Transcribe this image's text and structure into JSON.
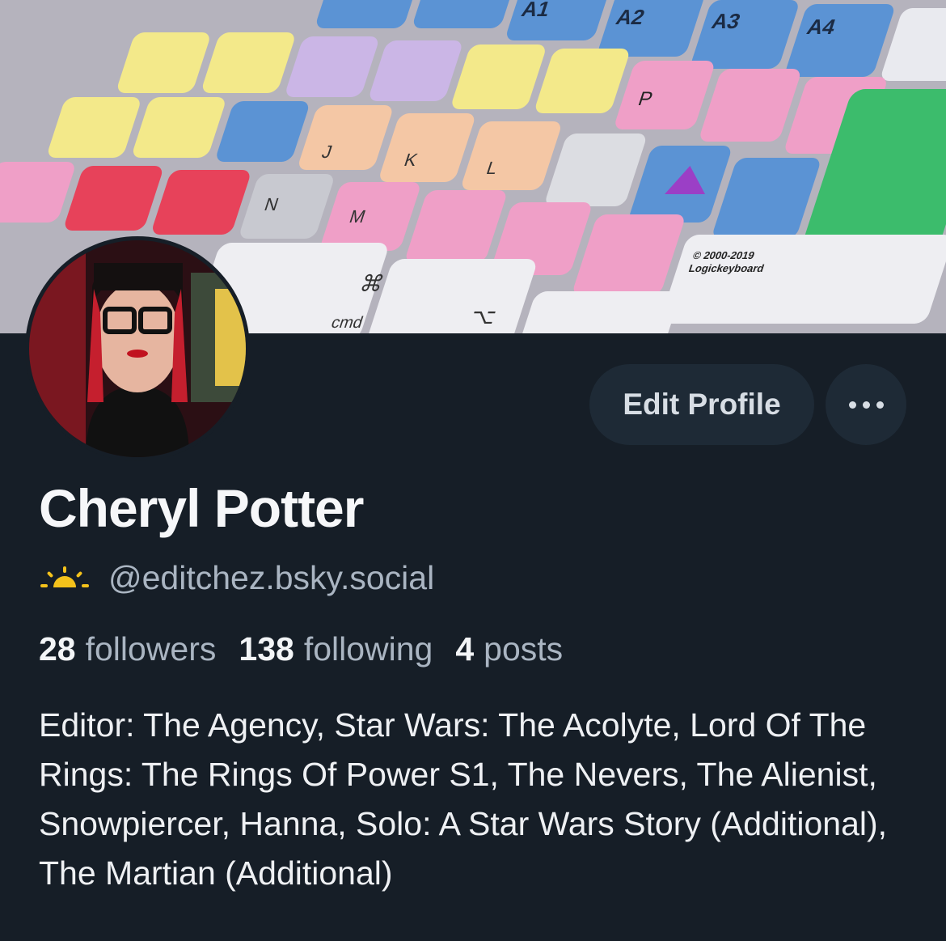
{
  "profile": {
    "display_name": "Cheryl Potter",
    "handle": "@editchez.bsky.social",
    "handle_icon": "sun-icon",
    "stats": {
      "followers_count": "28",
      "followers_label": "followers",
      "following_count": "138",
      "following_label": "following",
      "posts_count": "4",
      "posts_label": "posts"
    },
    "bio": "Editor: The Agency, Star Wars: The Acolyte, Lord Of The Rings: The Rings Of Power S1, The Nevers, The Alienist, Snowpiercer, Hanna, Solo: A Star Wars Story (Additional), The Martian (Additional)"
  },
  "actions": {
    "edit_profile_label": "Edit Profile",
    "more_icon": "ellipsis-icon"
  },
  "banner": {
    "keys": {
      "a1": "A1",
      "a2": "A2",
      "a3": "A3",
      "a4": "A4",
      "p": "P",
      "l": "L",
      "k": "K",
      "j": "J",
      "n": "N",
      "m": "M",
      "cmd": "cmd",
      "cmd_symbol": "⌘",
      "option_symbol": "⌥",
      "copyright_line1": "© 2000-2019",
      "copyright_line2": "Logickeyboard"
    }
  },
  "colors": {
    "background": "#161e27",
    "button_bg": "#1e2a36",
    "muted_text": "#aab5c2",
    "sun_icon": "#f4c21b"
  }
}
